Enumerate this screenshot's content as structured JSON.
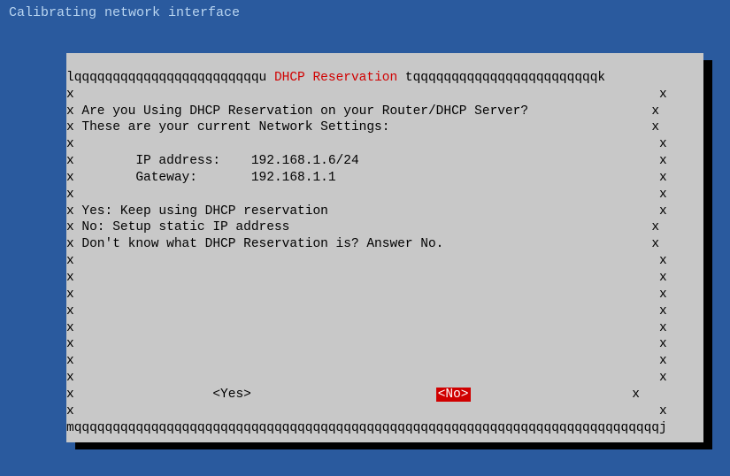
{
  "header": {
    "title": "Calibrating network interface"
  },
  "dialog": {
    "title": "DHCP Reservation",
    "border_top_left": "lqqqqqqqqqqqqqqqqqqqqqqqqu ",
    "border_top_right": " tqqqqqqqqqqqqqqqqqqqqqqqqk",
    "border_side_left": "x ",
    "border_side_right": "x",
    "border_side_left_tight": "x",
    "border_bottom": "mqqqqqqqqqqqqqqqqqqqqqqqqqqqqqqqqqqqqqqqqqqqqqqqqqqqqqqqqqqqqqqqqqqqqqqqqqqqqj",
    "lines": {
      "question": "Are you Using DHCP Reservation on your Router/DHCP Server?",
      "settings_intro": "These are your current Network Settings:",
      "ip_label": "       IP address:    ",
      "ip_value": "192.168.1.6/24",
      "gw_label": "       Gateway:       ",
      "gw_value": "192.168.1.1",
      "yes_desc": "Yes: Keep using DHCP reservation",
      "no_desc": "No: Setup static IP address",
      "dontknow": "Don't know what DHCP Reservation is? Answer No."
    },
    "buttons": {
      "yes": "<Yes>",
      "no": "<No>"
    }
  }
}
